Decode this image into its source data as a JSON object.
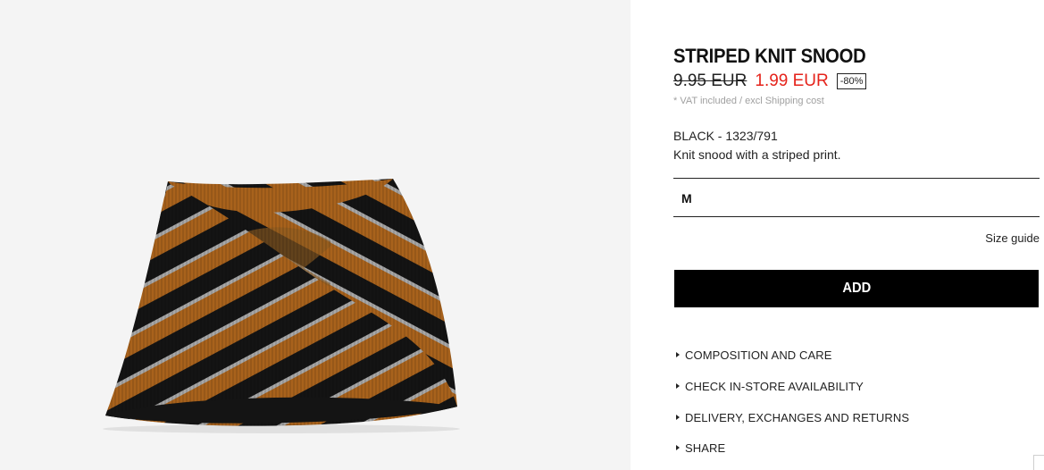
{
  "product": {
    "title": "STRIPED KNIT SNOOD",
    "price_old": "9.95 EUR",
    "price_new": "1.99 EUR",
    "discount": "-80%",
    "vat_note": "* VAT included / excl Shipping cost",
    "color_ref": "BLACK - 1323/791",
    "description": "Knit snood with a striped print.",
    "image_icon": "snood-photo"
  },
  "size": {
    "selected": "M",
    "guide_label": "Size guide"
  },
  "actions": {
    "add_label": "ADD"
  },
  "accordion": {
    "items": [
      {
        "label": "COMPOSITION AND CARE"
      },
      {
        "label": "CHECK IN-STORE AVAILABILITY"
      },
      {
        "label": "DELIVERY, EXCHANGES AND RETURNS"
      },
      {
        "label": "SHARE"
      }
    ]
  },
  "colors": {
    "sale_red": "#e5231b",
    "button_black": "#000000",
    "stripe_black": "#141414",
    "stripe_brown": "#a8621c",
    "stripe_grey": "#a7a7a7",
    "image_bg": "#f4f4f4"
  }
}
